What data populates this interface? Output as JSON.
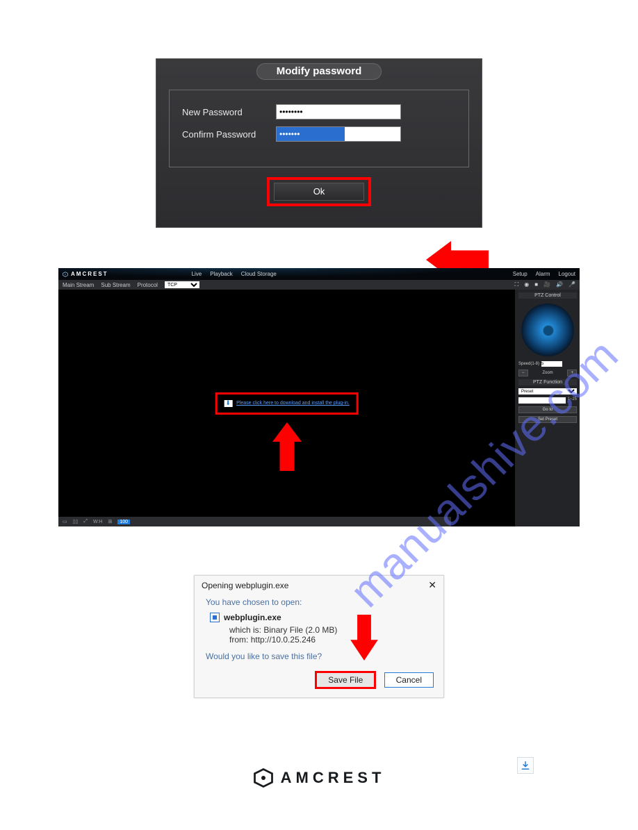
{
  "watermark": "manualshive.com",
  "modify_password": {
    "title": "Modify password",
    "new_label": "New Password",
    "confirm_label": "Confirm Password",
    "new_value": "••••••••",
    "confirm_value": "•••••••",
    "ok": "Ok"
  },
  "liveview": {
    "brand": "AMCREST",
    "nav": {
      "live": "Live",
      "playback": "Playback",
      "cloud": "Cloud Storage"
    },
    "topright": {
      "setup": "Setup",
      "alarm": "Alarm",
      "logout": "Logout"
    },
    "toolstrip": {
      "main": "Main Stream",
      "sub": "Sub Stream",
      "protocol_label": "Protocol",
      "protocol_value": "TCP"
    },
    "plugin_link": "Please click here to download and install the plug-in.",
    "ptz": {
      "header": "PTZ Control",
      "speed_label": "Speed(1-8)",
      "speed_value": "5",
      "zoom": "Zoom",
      "func_header": "PTZ Function",
      "preset": "Preset",
      "preset_range": "1~25",
      "goto": "Go to",
      "setpreset": "Set Preset"
    },
    "aspect_on": "100"
  },
  "savedlg": {
    "title": "Opening webplugin.exe",
    "chosen": "You have chosen to open:",
    "filename": "webplugin.exe",
    "whichis_label": "which is:",
    "whichis_value": "Binary File (2.0 MB)",
    "from_label": "from:",
    "from_value": "http://10.0.25.246",
    "question": "Would you like to save this file?",
    "save": "Save File",
    "cancel": "Cancel"
  },
  "footer_brand": "AMCREST"
}
